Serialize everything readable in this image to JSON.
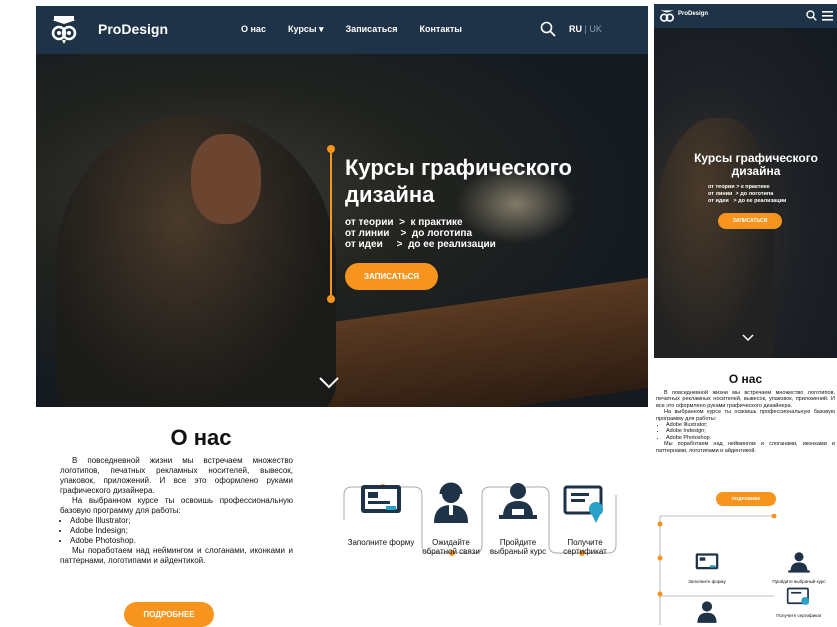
{
  "brand": "ProDesign",
  "nav": {
    "items": [
      "О нас",
      "Курсы ▾",
      "Записаться",
      "Контакты"
    ],
    "lang_ru": "RU",
    "lang_sep": "|",
    "lang_uk": "UK"
  },
  "hero": {
    "title": "Курсы графического дизайна",
    "lines": [
      {
        "from": "от теории",
        "arrow": ">",
        "to": "к практике"
      },
      {
        "from": "от линии",
        "arrow": ">",
        "to": "до логотипа"
      },
      {
        "from": "от идеи",
        "arrow": ">",
        "to": "до ее реализации"
      }
    ],
    "cta": "ЗАПИСАТЬСЯ"
  },
  "about": {
    "title": "О нас",
    "p1": "В повседневной жизни мы встречаем множество логотипов, печатных рекламных носителей, вывесок, упаковок, приложений. И все это оформлено руками графического дизайнера.",
    "p2": "На выбранном курсе ты освоишь профессиональную базовую программу для работы:",
    "list": [
      "Adobe Illustrator;",
      "Adobe Indesign;",
      "Adobe Photoshop."
    ],
    "p3": "Мы поработаем над неймингом и слоганами, иконками и паттернами, логотипами и айдентикой.",
    "button": "ПОДРОБНЕЕ"
  },
  "steps": [
    {
      "label": "Заполните форму",
      "icon": "form-icon"
    },
    {
      "label": "Ожидайте обратной связи",
      "icon": "operator-icon"
    },
    {
      "label": "Пройдите выбраный курс",
      "icon": "student-icon"
    },
    {
      "label": "Получите сертификат",
      "icon": "certificate-icon"
    }
  ],
  "colors": {
    "accent": "#f7941d",
    "navbar": "#1e3347"
  }
}
